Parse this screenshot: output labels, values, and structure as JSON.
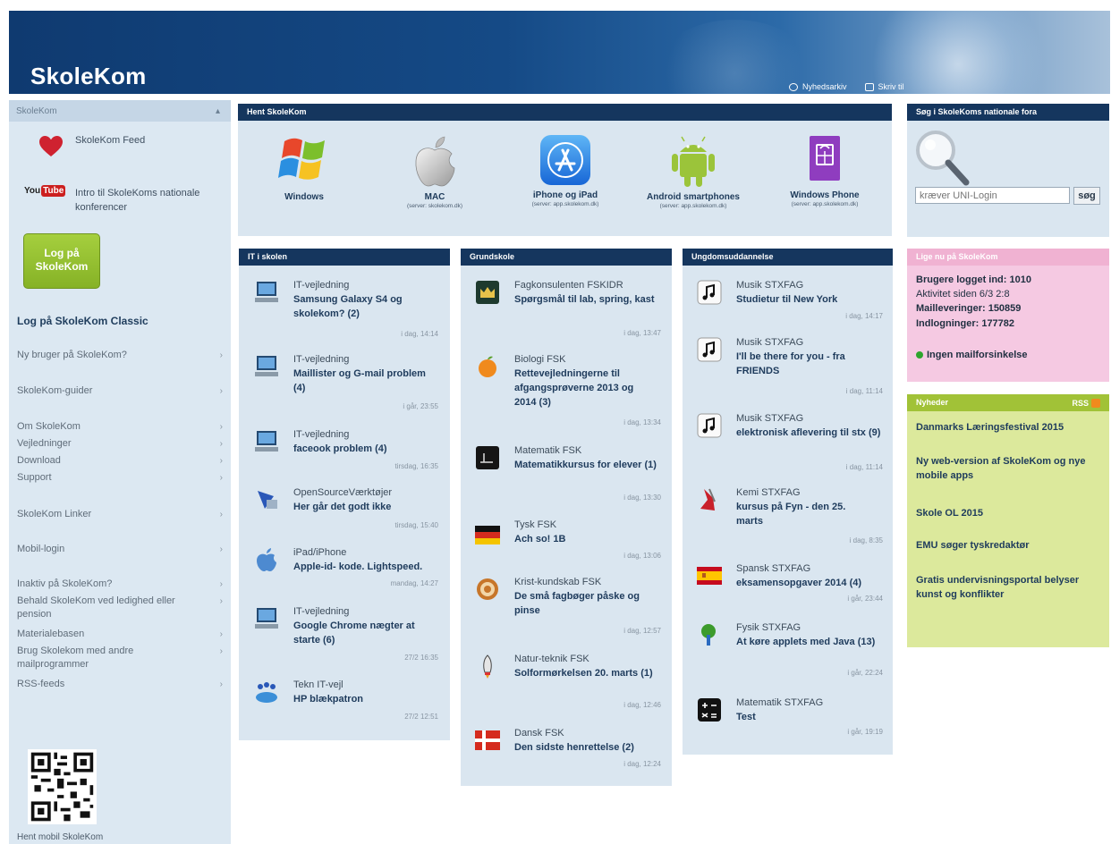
{
  "header": {
    "logo": "SkoleKom",
    "link_newsletter": "Nyhedsarkiv",
    "link_write": "Skriv til"
  },
  "sidebar": {
    "section_title": "SkoleKom",
    "feed_label": "SkoleKom Feed",
    "youtube_you": "You",
    "youtube_tube": "Tube",
    "intro_label": "Intro til SkoleKoms nationale konferencer",
    "login_button": "Log på SkoleKom",
    "classic_link": "Log på SkoleKom Classic",
    "items": [
      "Ny bruger på SkoleKom?",
      "SkoleKom-guider",
      "Om SkoleKom",
      "Vejledninger",
      "Download",
      "Support",
      "SkoleKom Linker",
      "Mobil-login",
      "Inaktiv på SkoleKom?",
      "Behald SkoleKom ved ledighed eller pension",
      "Materialebasen",
      "Brug Skolekom med andre mailprogrammer",
      "RSS-feeds"
    ],
    "qr_label": "Hent mobil SkoleKom"
  },
  "download": {
    "title": "Hent SkoleKom",
    "apps": [
      {
        "label": "Windows",
        "sub": "",
        "icon": "windows-logo-icon"
      },
      {
        "label": "MAC",
        "sub": "(server: skolekom.dk)",
        "icon": "apple-logo-icon"
      },
      {
        "label": "iPhone og iPad",
        "sub": "(server: app.skolekom.dk)",
        "icon": "app-store-icon"
      },
      {
        "label": "Android smartphones",
        "sub": "(server: app.skolekom.dk)",
        "icon": "android-icon"
      },
      {
        "label": "Windows Phone",
        "sub": "(server: app.skolekom.dk)",
        "icon": "windows-phone-icon"
      }
    ]
  },
  "columns": [
    {
      "title": "IT i skolen",
      "items": [
        {
          "cat": "IT-vejledning",
          "title": "Samsung Galaxy S4 og skolekom? (2)",
          "time": "i dag, 14:14",
          "icon": "computer-icon"
        },
        {
          "cat": "IT-vejledning",
          "title": "Maillister og G-mail problem (4)",
          "time": "i går, 23:55",
          "icon": "computer-icon"
        },
        {
          "cat": "IT-vejledning",
          "title": "faceook problem (4)",
          "time": "tirsdag, 16:35",
          "icon": "computer-icon"
        },
        {
          "cat": "OpenSourceVærktøjer",
          "title": "Her går det godt ikke",
          "time": "tirsdag, 15:40",
          "icon": "opensource-icon"
        },
        {
          "cat": "iPad/iPhone",
          "title": "Apple-id- kode. Lightspeed.",
          "time": "mandag, 14:27",
          "icon": "apple-icon"
        },
        {
          "cat": "IT-vejledning",
          "title": "Google Chrome nægter at starte (6)",
          "time": "27/2 16:35",
          "icon": "computer-icon"
        },
        {
          "cat": "Tekn IT-vejl",
          "title": "HP blækpatron",
          "time": "27/2 12:51",
          "icon": "people-icon"
        }
      ]
    },
    {
      "title": "Grundskole",
      "items": [
        {
          "cat": "Fagkonsulenten FSKIDR",
          "title": "Spørgsmål til lab, spring, kast",
          "time": "i dag, 13:47",
          "icon": "crown-icon"
        },
        {
          "cat": "Biologi FSK",
          "title": "Rettevejledningerne til afgangsprøverne 2013 og 2014 (3)",
          "time": "i dag, 13:34",
          "icon": "fruit-icon"
        },
        {
          "cat": "Matematik FSK",
          "title": "Matematikkursus for elever (1)",
          "time": "i dag, 13:30",
          "icon": "math-icon"
        },
        {
          "cat": "Tysk FSK",
          "title": "Ach so! 1B",
          "time": "i dag, 13:06",
          "icon": "german-flag-icon"
        },
        {
          "cat": "Krist-kundskab FSK",
          "title": "De små fagbøger påske og pinse",
          "time": "i dag, 12:57",
          "icon": "target-icon"
        },
        {
          "cat": "Natur-teknik FSK",
          "title": "Solformørkelsen 20. marts (1)",
          "time": "i dag, 12:46",
          "icon": "rocket-icon"
        },
        {
          "cat": "Dansk FSK",
          "title": "Den sidste henrettelse (2)",
          "time": "i dag, 12:24",
          "icon": "danish-flag-icon"
        }
      ]
    },
    {
      "title": "Ungdomsuddannelse",
      "items": [
        {
          "cat": "Musik STXFAG",
          "title": "Studietur til New York",
          "time": "i dag, 14:17",
          "icon": "music-note-icon"
        },
        {
          "cat": "Musik STXFAG",
          "title": "I'll be there for you - fra FRIENDS",
          "time": "i dag, 11:14",
          "icon": "music-note-icon"
        },
        {
          "cat": "Musik STXFAG",
          "title": "elektronisk aflevering til stx (9)",
          "time": "i dag, 11:14",
          "icon": "music-note-icon"
        },
        {
          "cat": "Kemi STXFAG",
          "title": "kursus på Fyn - den 25. marts",
          "time": "i dag, 8:35",
          "icon": "chemistry-icon"
        },
        {
          "cat": "Spansk STXFAG",
          "title": "eksamensopgaver 2014 (4)",
          "time": "i går, 23:44",
          "icon": "spanish-flag-icon"
        },
        {
          "cat": "Fysik STXFAG",
          "title": "At køre applets med Java (13)",
          "time": "i går, 22:24",
          "icon": "tree-icon"
        },
        {
          "cat": "Matematik STXFAG",
          "title": "Test",
          "time": "i går, 19:19",
          "icon": "calculator-icon"
        }
      ]
    }
  ],
  "search": {
    "title": "Søg i SkoleKoms nationale fora",
    "placeholder": "kræver UNI-Login",
    "button": "søg"
  },
  "online": {
    "title": "Lige nu på SkoleKom",
    "users_label": "Brugere logget ind:",
    "users_value": "1010",
    "activity": "Aktivitet siden 6/3 2:8",
    "mail": "Mailleveringer: 150859",
    "logins": "Indlogninger: 177782",
    "status": "Ingen mailforsinkelse",
    "status_color": "#2da52d"
  },
  "news": {
    "title": "Nyheder",
    "rss": "RSS",
    "items": [
      "Danmarks Læringsfestival 2015",
      "Ny web-version af SkoleKom og nye mobile apps",
      "Skole OL 2015",
      "EMU søger tyskredaktør",
      "Gratis undervisningsportal belyser kunst og konflikter"
    ]
  }
}
